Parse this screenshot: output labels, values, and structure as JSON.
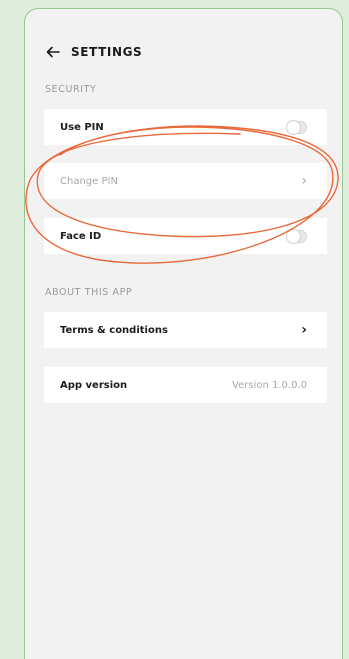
{
  "header": {
    "title": "SETTINGS",
    "back_icon": "arrow-left-icon"
  },
  "security": {
    "label": "SECURITY",
    "items": [
      {
        "label": "Use PIN",
        "control": "toggle",
        "on": false
      },
      {
        "label": "Change PIN",
        "control": "chevron",
        "disabled": true
      },
      {
        "label": "Face ID",
        "control": "toggle",
        "on": false
      }
    ]
  },
  "about": {
    "label": "ABOUT THIS APP",
    "terms": {
      "label": "Terms & conditions",
      "chevron": "›"
    },
    "version": {
      "label": "App version",
      "value": "Version 1.0.0.0"
    }
  },
  "chevrons": {
    "dim": "›"
  },
  "colors": {
    "annotation": "#e8693a",
    "frame_border": "#93c88e",
    "background": "#f2f2f2"
  }
}
